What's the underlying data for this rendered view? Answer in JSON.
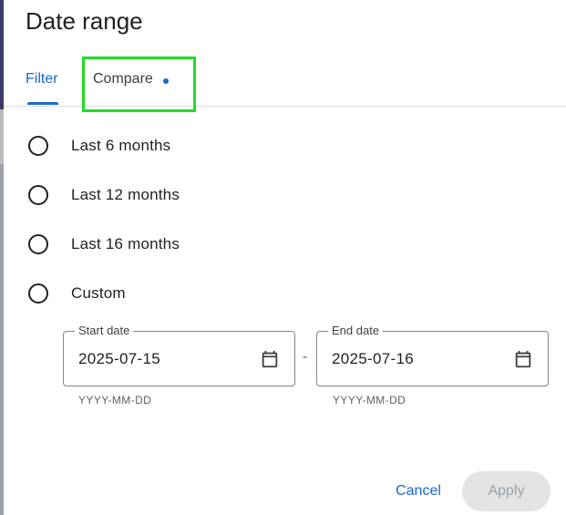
{
  "dialog": {
    "title": "Date range"
  },
  "tabs": [
    {
      "label": "Filter",
      "selected": true
    },
    {
      "label": "Compare",
      "has_indicator_dot": true,
      "highlighted": true
    }
  ],
  "options": [
    {
      "label": "Last 6 months",
      "selected": false
    },
    {
      "label": "Last 12 months",
      "selected": false
    },
    {
      "label": "Last 16 months",
      "selected": false
    },
    {
      "label": "Custom",
      "selected": false
    }
  ],
  "custom_range": {
    "start": {
      "label": "Start date",
      "value": "2025-07-15",
      "hint": "YYYY-MM-DD",
      "icon": "calendar-icon"
    },
    "separator": "-",
    "end": {
      "label": "End date",
      "value": "2025-07-16",
      "hint": "YYYY-MM-DD",
      "icon": "calendar-icon"
    }
  },
  "actions": {
    "cancel_label": "Cancel",
    "apply_label": "Apply",
    "apply_enabled": false
  },
  "colors": {
    "accent": "#1967d2",
    "highlight_box": "#22dd22",
    "disabled_bg": "#e3e3e3"
  }
}
